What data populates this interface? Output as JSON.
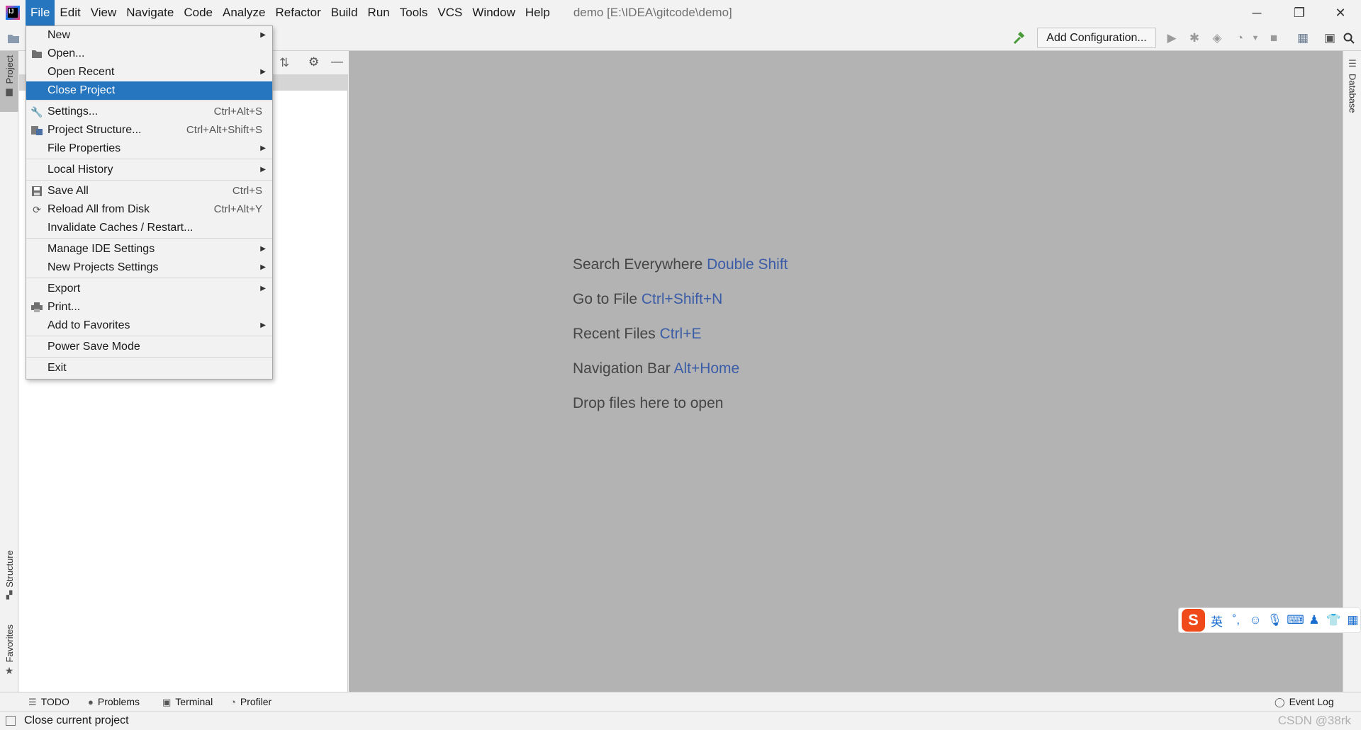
{
  "app": {
    "menus": [
      "File",
      "Edit",
      "View",
      "Navigate",
      "Code",
      "Analyze",
      "Refactor",
      "Build",
      "Run",
      "Tools",
      "VCS",
      "Window",
      "Help"
    ],
    "window_title": "demo [E:\\IDEA\\gitcode\\demo]",
    "window_controls": {
      "minimize": "─",
      "restore": "❐",
      "close": "✕"
    }
  },
  "toolbar": {
    "add_configuration": "Add Configuration..."
  },
  "file_menu": {
    "items": [
      {
        "label": "New",
        "shortcut": "",
        "submenu": true,
        "icon": ""
      },
      {
        "label": "Open...",
        "shortcut": "",
        "submenu": false,
        "icon": "folder-open-icon"
      },
      {
        "label": "Open Recent",
        "shortcut": "",
        "submenu": true,
        "icon": ""
      },
      {
        "label": "Close Project",
        "shortcut": "",
        "submenu": false,
        "icon": "",
        "selected": true
      },
      {
        "label": "Settings...",
        "shortcut": "Ctrl+Alt+S",
        "submenu": false,
        "icon": "wrench-icon"
      },
      {
        "label": "Project Structure...",
        "shortcut": "Ctrl+Alt+Shift+S",
        "submenu": false,
        "icon": "project-structure-icon"
      },
      {
        "label": "File Properties",
        "shortcut": "",
        "submenu": true,
        "icon": ""
      },
      {
        "label": "Local History",
        "shortcut": "",
        "submenu": true,
        "icon": ""
      },
      {
        "label": "Save All",
        "shortcut": "Ctrl+S",
        "submenu": false,
        "icon": "save-icon"
      },
      {
        "label": "Reload All from Disk",
        "shortcut": "Ctrl+Alt+Y",
        "submenu": false,
        "icon": "reload-icon"
      },
      {
        "label": "Invalidate Caches / Restart...",
        "shortcut": "",
        "submenu": false,
        "icon": ""
      },
      {
        "label": "Manage IDE Settings",
        "shortcut": "",
        "submenu": true,
        "icon": ""
      },
      {
        "label": "New Projects Settings",
        "shortcut": "",
        "submenu": true,
        "icon": ""
      },
      {
        "label": "Export",
        "shortcut": "",
        "submenu": true,
        "icon": ""
      },
      {
        "label": "Print...",
        "shortcut": "",
        "submenu": false,
        "icon": "print-icon"
      },
      {
        "label": "Add to Favorites",
        "shortcut": "",
        "submenu": true,
        "icon": ""
      },
      {
        "label": "Power Save Mode",
        "shortcut": "",
        "submenu": false,
        "icon": ""
      },
      {
        "label": "Exit",
        "shortcut": "",
        "submenu": false,
        "icon": ""
      }
    ]
  },
  "left_stripe": {
    "project": "Project",
    "structure": "Structure",
    "favorites": "Favorites"
  },
  "right_stripe": {
    "database": "Database"
  },
  "editor_hints": [
    {
      "text": "Search Everywhere",
      "key": "Double Shift"
    },
    {
      "text": "Go to File",
      "key": "Ctrl+Shift+N"
    },
    {
      "text": "Recent Files",
      "key": "Ctrl+E"
    },
    {
      "text": "Navigation Bar",
      "key": "Alt+Home"
    },
    {
      "text": "Drop files here to open",
      "key": ""
    }
  ],
  "bottom_tabs": {
    "todo": "TODO",
    "problems": "Problems",
    "terminal": "Terminal",
    "profiler": "Profiler",
    "event_log": "Event Log"
  },
  "status": {
    "text": "Close current project",
    "watermark": "CSDN @38rk"
  },
  "ime": {
    "mode": "英",
    "punct": "˚,",
    "logo": "S"
  },
  "colors": {
    "accent": "#2675bf",
    "hint_key": "#3b5da7",
    "editor_bg": "#b3b3b3"
  }
}
